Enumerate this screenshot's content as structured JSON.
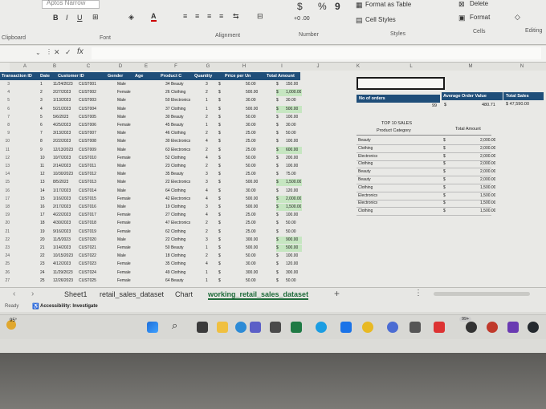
{
  "ribbon": {
    "font_name": "Aptos Narrow",
    "groups": {
      "clipboard": "Clipboard",
      "font": "Font",
      "alignment": "Alignment",
      "number": "Number",
      "styles": "Styles",
      "cells": "Cells",
      "editing": "Editing"
    },
    "format_as_table": "Format as Table",
    "cell_styles": "Cell Styles",
    "delete": "Delete",
    "format": "Format",
    "currency_symbol": "$",
    "percent_symbol": "%",
    "comma_symbol": "9"
  },
  "formula_bar": {
    "fx": "fx",
    "cell_ref": ""
  },
  "columns": [
    "A",
    "B",
    "C",
    "D",
    "E",
    "F",
    "G",
    "H",
    "I",
    "J",
    "K",
    "L",
    "M",
    "N"
  ],
  "table": {
    "headers": [
      "Transaction ID",
      "Date",
      "Customer ID",
      "Gender",
      "Age",
      "Product C",
      "Quantity",
      "Price per Un",
      "Total Amount"
    ],
    "rows": [
      [
        "1",
        "11/24/2023",
        "CUST001",
        "Male",
        "",
        "34 Beauty",
        "3",
        "$",
        "50.00",
        "$",
        "150.00"
      ],
      [
        "2",
        "2/27/2023",
        "CUST002",
        "Female",
        "",
        "26 Clothing",
        "2",
        "$",
        "500.00",
        "$",
        "1,000.00"
      ],
      [
        "3",
        "1/13/2023",
        "CUST003",
        "Male",
        "",
        "50 Electronics",
        "1",
        "$",
        "30.00",
        "$",
        "30.00"
      ],
      [
        "4",
        "5/21/2023",
        "CUST004",
        "Male",
        "",
        "37 Clothing",
        "1",
        "$",
        "500.00",
        "$",
        "500.00"
      ],
      [
        "5",
        "5/6/2023",
        "CUST005",
        "Male",
        "",
        "30 Beauty",
        "2",
        "$",
        "50.00",
        "$",
        "100.00"
      ],
      [
        "6",
        "4/25/2023",
        "CUST006",
        "Female",
        "",
        "45 Beauty",
        "1",
        "$",
        "30.00",
        "$",
        "30.00"
      ],
      [
        "7",
        "3/13/2023",
        "CUST007",
        "Male",
        "",
        "46 Clothing",
        "2",
        "$",
        "25.00",
        "$",
        "50.00"
      ],
      [
        "8",
        "2/22/2023",
        "CUST008",
        "Male",
        "",
        "30 Electronics",
        "4",
        "$",
        "25.00",
        "$",
        "100.00"
      ],
      [
        "9",
        "12/13/2023",
        "CUST009",
        "Male",
        "",
        "63 Electronics",
        "2",
        "$",
        "25.00",
        "$",
        "600.00"
      ],
      [
        "10",
        "10/7/2023",
        "CUST010",
        "Female",
        "",
        "52 Clothing",
        "4",
        "$",
        "50.00",
        "$",
        "200.00"
      ],
      [
        "11",
        "2/14/2023",
        "CUST011",
        "Male",
        "",
        "23 Clothing",
        "2",
        "$",
        "50.00",
        "$",
        "100.00"
      ],
      [
        "12",
        "10/30/2023",
        "CUST012",
        "Male",
        "",
        "35 Beauty",
        "3",
        "$",
        "25.00",
        "$",
        "75.00"
      ],
      [
        "13",
        "8/5/2023",
        "CUST013",
        "Male",
        "",
        "22 Electronics",
        "3",
        "$",
        "500.00",
        "$",
        "1,500.00"
      ],
      [
        "14",
        "1/17/2023",
        "CUST014",
        "Male",
        "",
        "64 Clothing",
        "4",
        "$",
        "30.00",
        "$",
        "120.00"
      ],
      [
        "15",
        "1/16/2023",
        "CUST015",
        "Female",
        "",
        "42 Electronics",
        "4",
        "$",
        "500.00",
        "$",
        "2,000.00"
      ],
      [
        "16",
        "2/17/2023",
        "CUST016",
        "Male",
        "",
        "19 Clothing",
        "3",
        "$",
        "500.00",
        "$",
        "1,500.00"
      ],
      [
        "17",
        "4/22/2023",
        "CUST017",
        "Female",
        "",
        "27 Clothing",
        "4",
        "$",
        "25.00",
        "$",
        "100.00"
      ],
      [
        "18",
        "4/30/2023",
        "CUST018",
        "Female",
        "",
        "47 Electronics",
        "2",
        "$",
        "25.00",
        "$",
        "50.00"
      ],
      [
        "19",
        "9/16/2023",
        "CUST019",
        "Female",
        "",
        "62 Clothing",
        "2",
        "$",
        "25.00",
        "$",
        "50.00"
      ],
      [
        "20",
        "11/5/2023",
        "CUST020",
        "Male",
        "",
        "22 Clothing",
        "3",
        "$",
        "300.00",
        "$",
        "900.00"
      ],
      [
        "21",
        "1/14/2023",
        "CUST021",
        "Female",
        "",
        "50 Beauty",
        "1",
        "$",
        "500.00",
        "$",
        "500.00"
      ],
      [
        "22",
        "10/15/2023",
        "CUST022",
        "Male",
        "",
        "18 Clothing",
        "2",
        "$",
        "50.00",
        "$",
        "100.00"
      ],
      [
        "23",
        "4/12/2023",
        "CUST023",
        "Female",
        "",
        "35 Clothing",
        "4",
        "$",
        "30.00",
        "$",
        "120.00"
      ],
      [
        "24",
        "11/29/2023",
        "CUST024",
        "Female",
        "",
        "49 Clothing",
        "1",
        "$",
        "300.00",
        "$",
        "300.00"
      ],
      [
        "25",
        "12/26/2023",
        "CUST025",
        "Female",
        "",
        "64 Beauty",
        "1",
        "$",
        "50.00",
        "$",
        "50.00"
      ]
    ],
    "highlighted_rows": [
      1,
      3,
      8,
      12,
      14,
      15,
      19,
      20
    ]
  },
  "summary": {
    "no_of_orders_label": "No of orders",
    "no_of_orders_value": "99",
    "avg_label": "Average Order Value",
    "avg_value": "480.71",
    "total_label": "Total Sales",
    "total_value": "$ 47,590.00",
    "currency": "$"
  },
  "pivot": {
    "title": "TOP 10 SALES",
    "col1": "Product Category",
    "col2": "Total Amount",
    "rows": [
      [
        "Beauty",
        "$",
        "2,000.00"
      ],
      [
        "Clothing",
        "$",
        "2,000.00"
      ],
      [
        "Electronics",
        "$",
        "2,000.00"
      ],
      [
        "Clothing",
        "$",
        "2,000.00"
      ],
      [
        "Beauty",
        "$",
        "2,000.00"
      ],
      [
        "Beauty",
        "$",
        "2,000.00"
      ],
      [
        "Clothing",
        "$",
        "1,500.00"
      ],
      [
        "Electronics",
        "$",
        "1,500.00"
      ],
      [
        "Electronics",
        "$",
        "1,500.00"
      ],
      [
        "Clothing",
        "$",
        "1,500.00"
      ]
    ]
  },
  "sheet_tabs": [
    "Sheet1",
    "retail_sales_dataset",
    "Chart",
    "working_retail_sales_dataset"
  ],
  "active_tab": "working_retail_sales_dataset",
  "status": {
    "ready": "Ready",
    "accessibility": "Accessibility: Investigate"
  },
  "taskbar": {
    "weather": "95°",
    "badge": "99+"
  }
}
